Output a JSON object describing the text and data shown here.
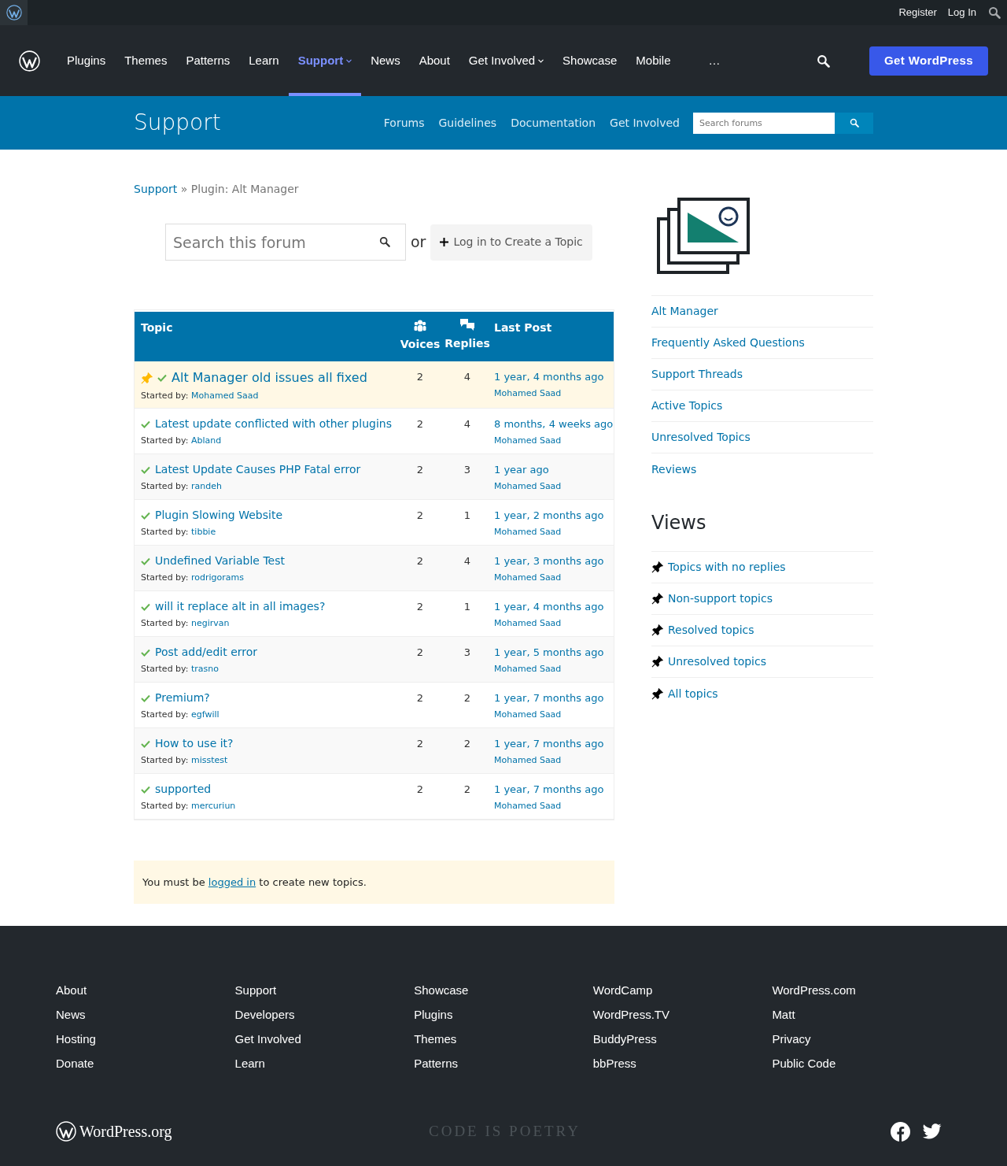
{
  "admin_bar": {
    "links": [
      "Register",
      "Log In"
    ]
  },
  "nav": {
    "items": [
      {
        "label": "Plugins",
        "selected": false,
        "dropdown": false
      },
      {
        "label": "Themes",
        "selected": false,
        "dropdown": false
      },
      {
        "label": "Patterns",
        "selected": false,
        "dropdown": false
      },
      {
        "label": "Learn",
        "selected": false,
        "dropdown": false
      },
      {
        "label": "Support",
        "selected": true,
        "dropdown": true
      },
      {
        "label": "News",
        "selected": false,
        "dropdown": false
      },
      {
        "label": "About",
        "selected": false,
        "dropdown": false
      },
      {
        "label": "Get Involved",
        "selected": false,
        "dropdown": true
      },
      {
        "label": "Showcase",
        "selected": false,
        "dropdown": false
      },
      {
        "label": "Mobile",
        "selected": false,
        "dropdown": false
      },
      {
        "label": "…",
        "selected": false,
        "dropdown": false
      }
    ],
    "cta": "Get WordPress"
  },
  "support_bar": {
    "title": "Support",
    "links": [
      "Forums",
      "Guidelines",
      "Documentation",
      "Get Involved"
    ],
    "search_placeholder": "Search forums"
  },
  "breadcrumb": {
    "link": "Support",
    "separator": "»",
    "current": "Plugin: Alt Manager"
  },
  "forum_search": {
    "placeholder": "Search this forum",
    "or": "or",
    "create_button": "Log in to Create a Topic"
  },
  "table": {
    "columns": {
      "topic": "Topic",
      "voices": "Voices",
      "replies": "Replies",
      "last_post": "Last Post"
    },
    "rows": [
      {
        "title": "Alt Manager old issues all fixed",
        "started_by": "Started by:",
        "author": "Mohamed Saad",
        "voices": "2",
        "replies": "4",
        "freshness": "1 year, 4 months ago",
        "last_author": "Mohamed Saad",
        "sticky": true,
        "resolved": true
      },
      {
        "title": "Latest update conflicted with other plugins",
        "started_by": "Started by:",
        "author": "Abland",
        "voices": "2",
        "replies": "4",
        "freshness": "8 months, 4 weeks ago",
        "last_author": "Mohamed Saad",
        "sticky": false,
        "resolved": true
      },
      {
        "title": "Latest Update Causes PHP Fatal error",
        "started_by": "Started by:",
        "author": "randeh",
        "voices": "2",
        "replies": "3",
        "freshness": "1 year ago",
        "last_author": "Mohamed Saad",
        "sticky": false,
        "resolved": true
      },
      {
        "title": "Plugin Slowing Website",
        "started_by": "Started by:",
        "author": "tibbie",
        "voices": "2",
        "replies": "1",
        "freshness": "1 year, 2 months ago",
        "last_author": "Mohamed Saad",
        "sticky": false,
        "resolved": true
      },
      {
        "title": "Undefined Variable Test",
        "started_by": "Started by:",
        "author": "rodrigorams",
        "voices": "2",
        "replies": "4",
        "freshness": "1 year, 3 months ago",
        "last_author": "Mohamed Saad",
        "sticky": false,
        "resolved": true
      },
      {
        "title": "will it replace alt in all images?",
        "started_by": "Started by:",
        "author": "negirvan",
        "voices": "2",
        "replies": "1",
        "freshness": "1 year, 4 months ago",
        "last_author": "Mohamed Saad",
        "sticky": false,
        "resolved": true
      },
      {
        "title": "Post add/edit error",
        "started_by": "Started by:",
        "author": "trasno",
        "voices": "2",
        "replies": "3",
        "freshness": "1 year, 5 months ago",
        "last_author": "Mohamed Saad",
        "sticky": false,
        "resolved": true
      },
      {
        "title": "Premium?",
        "started_by": "Started by:",
        "author": "egfwill",
        "voices": "2",
        "replies": "2",
        "freshness": "1 year, 7 months ago",
        "last_author": "Mohamed Saad",
        "sticky": false,
        "resolved": true
      },
      {
        "title": "How to use it?",
        "started_by": "Started by:",
        "author": "misstest",
        "voices": "2",
        "replies": "2",
        "freshness": "1 year, 7 months ago",
        "last_author": "Mohamed Saad",
        "sticky": false,
        "resolved": true
      },
      {
        "title": "supported",
        "started_by": "Started by:",
        "author": "mercuriun",
        "voices": "2",
        "replies": "2",
        "freshness": "1 year, 7 months ago",
        "last_author": "Mohamed Saad",
        "sticky": false,
        "resolved": true
      }
    ]
  },
  "notice": {
    "before": "You must be",
    "link": "logged in",
    "after": "to create new topics."
  },
  "sidebar": {
    "links": [
      "Alt Manager",
      "Frequently Asked Questions",
      "Support Threads",
      "Active Topics",
      "Unresolved Topics",
      "Reviews"
    ],
    "views_title": "Views",
    "views": [
      "Topics with no replies",
      "Non-support topics",
      "Resolved topics",
      "Unresolved topics",
      "All topics"
    ]
  },
  "footer": {
    "columns": [
      [
        "About",
        "News",
        "Hosting",
        "Donate"
      ],
      [
        "Support",
        "Developers",
        "Get Involved",
        "Learn"
      ],
      [
        "Showcase",
        "Plugins",
        "Themes",
        "Patterns"
      ],
      [
        "WordCamp",
        "WordPress.TV",
        "BuddyPress",
        "bbPress"
      ],
      [
        "WordPress.com",
        "Matt",
        "Privacy",
        "Public Code"
      ]
    ],
    "logo_text": "WordPress.org",
    "tagline": "CODE IS POETRY"
  }
}
